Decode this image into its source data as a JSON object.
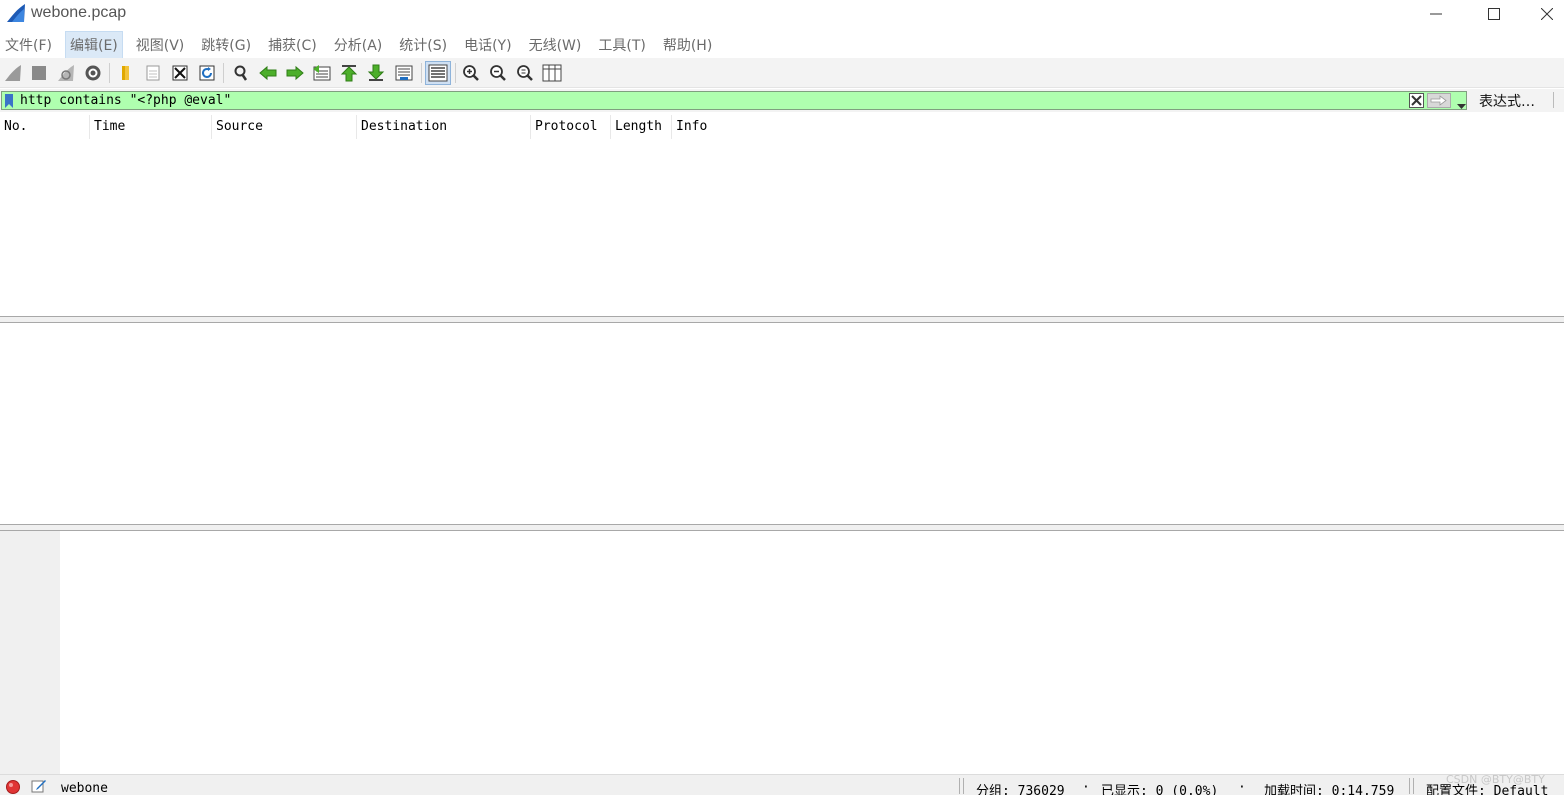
{
  "window": {
    "title": "webone.pcap"
  },
  "menu": [
    {
      "label": "文件(F)",
      "active": false
    },
    {
      "label": "编辑(E)",
      "active": true
    },
    {
      "label": "视图(V)",
      "active": false
    },
    {
      "label": "跳转(G)",
      "active": false
    },
    {
      "label": "捕获(C)",
      "active": false
    },
    {
      "label": "分析(A)",
      "active": false
    },
    {
      "label": "统计(S)",
      "active": false
    },
    {
      "label": "电话(Y)",
      "active": false
    },
    {
      "label": "无线(W)",
      "active": false
    },
    {
      "label": "工具(T)",
      "active": false
    },
    {
      "label": "帮助(H)",
      "active": false
    }
  ],
  "filter": {
    "value": "http contains \"<?php @eval\"",
    "expression_label": "表达式…",
    "color_valid": "#afffaf"
  },
  "packet_list": {
    "columns": [
      "No.",
      "Time",
      "Source",
      "Destination",
      "Protocol",
      "Length",
      "Info"
    ],
    "rows": []
  },
  "status": {
    "file_name": "webone",
    "packets": "分组: 736029",
    "displayed": "已显示: 0 (0.0%)",
    "load_time": "加载时间: 0:14.759",
    "profile": "配置文件: Default",
    "watermark": "CSDN @BTY@BTY"
  },
  "icons": {
    "logo": "wireshark-fin-icon",
    "toolbar": [
      "start-capture-icon",
      "stop-capture-icon",
      "restart-capture-icon",
      "capture-options-icon",
      "open-file-icon",
      "save-file-icon",
      "close-file-icon",
      "reload-file-icon",
      "find-packet-icon",
      "go-back-icon",
      "go-forward-icon",
      "go-to-packet-icon",
      "go-first-icon",
      "go-last-icon",
      "auto-scroll-icon",
      "colorize-icon",
      "zoom-in-icon",
      "zoom-out-icon",
      "zoom-normal-icon",
      "resize-columns-icon"
    ]
  }
}
